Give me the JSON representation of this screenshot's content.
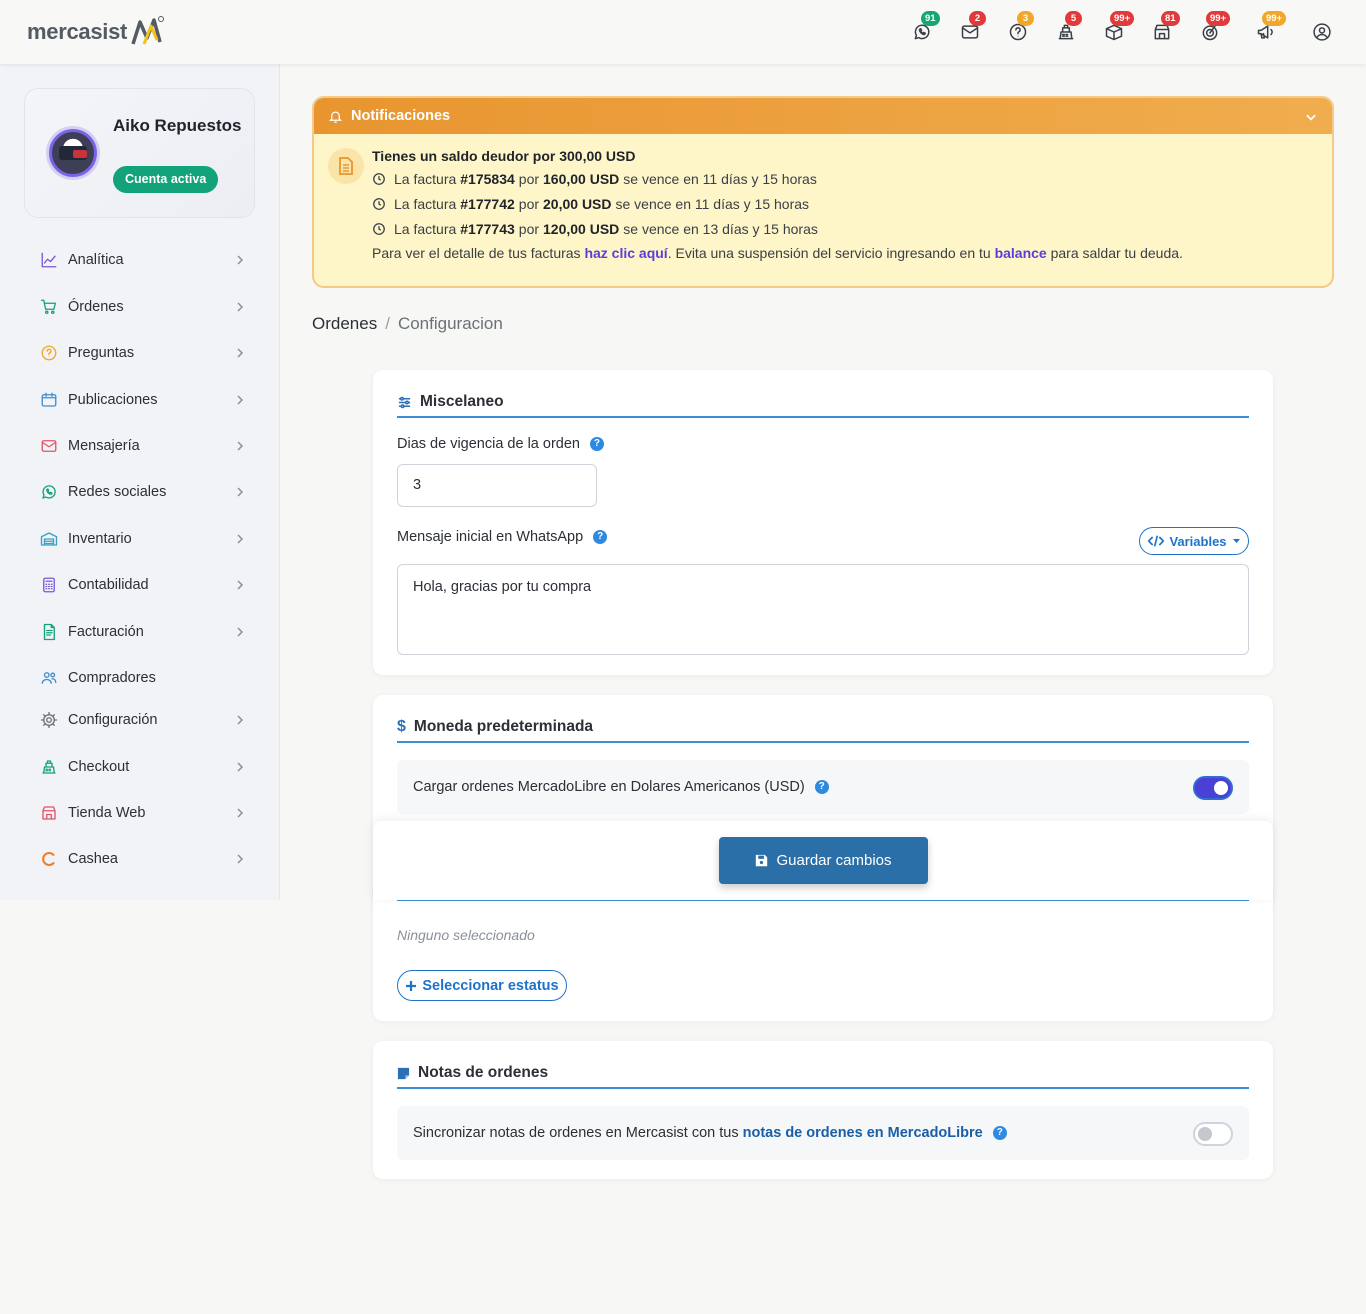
{
  "app": {
    "logo_text": "mercasist"
  },
  "topbar": {
    "icons": [
      {
        "name": "whatsapp-icon",
        "badge": "91",
        "color": "#17a673"
      },
      {
        "name": "mail-icon",
        "badge": "2",
        "color": "#e03a3a"
      },
      {
        "name": "question-icon",
        "badge": "3",
        "color": "#f0a72a"
      },
      {
        "name": "register-icon",
        "badge": "5",
        "color": "#e03a3a"
      },
      {
        "name": "package-icon",
        "badge": "99+",
        "color": "#e03a3a"
      },
      {
        "name": "store-icon",
        "badge": "81",
        "color": "#e03a3a"
      },
      {
        "name": "target-icon",
        "badge": "99+",
        "color": "#e03a3a"
      },
      {
        "name": "megaphone-icon",
        "badge": "99+",
        "color": "#f0a72a"
      },
      {
        "name": "user-icon",
        "badge": "",
        "color": ""
      }
    ]
  },
  "profile": {
    "name": "Aiko Repuestos",
    "status": "Cuenta activa"
  },
  "sidebar": {
    "items": [
      {
        "label": "Analítica",
        "icon": "chart-icon",
        "color": "#7a5ad9",
        "chevron": true
      },
      {
        "label": "Órdenes",
        "icon": "cart-icon",
        "color": "#12a37a",
        "chevron": true
      },
      {
        "label": "Preguntas",
        "icon": "question-icon",
        "color": "#f0a72a",
        "chevron": true
      },
      {
        "label": "Publicaciones",
        "icon": "calendar-icon",
        "color": "#3d8fd1",
        "chevron": true
      },
      {
        "label": "Mensajería",
        "icon": "mail-icon",
        "color": "#e0566b",
        "chevron": true
      },
      {
        "label": "Redes sociales",
        "icon": "whatsapp-icon",
        "color": "#12a37a",
        "chevron": true
      },
      {
        "label": "Inventario",
        "icon": "warehouse-icon",
        "color": "#3aa0c8",
        "chevron": true
      },
      {
        "label": "Contabilidad",
        "icon": "calculator-icon",
        "color": "#7a5ad9",
        "chevron": true
      },
      {
        "label": "Facturación",
        "icon": "invoice-icon",
        "color": "#12a37a",
        "chevron": true
      },
      {
        "label": "Compradores",
        "icon": "users-icon",
        "color": "#3d8fd1",
        "chevron": false
      },
      {
        "label": "Configuración",
        "icon": "gear-icon",
        "color": "#6b7178",
        "chevron": true
      },
      {
        "label": "Checkout",
        "icon": "register-icon",
        "color": "#12a37a",
        "chevron": true
      },
      {
        "label": "Tienda Web",
        "icon": "store-icon",
        "color": "#e0566b",
        "chevron": true
      },
      {
        "label": "Cashea",
        "icon": "cashea-icon",
        "color": "#f07f2a",
        "chevron": true
      }
    ]
  },
  "notifications": {
    "title": "Notificaciones",
    "debt_title": "Tienes un saldo deudor por 300,00 USD",
    "invoices": [
      {
        "prefix": "La factura",
        "number": "#175834",
        "por": "por",
        "amount": "160,00 USD",
        "due": "se vence en 11 días y 15 horas"
      },
      {
        "prefix": "La factura",
        "number": "#177742",
        "por": "por",
        "amount": "20,00 USD",
        "due": "se vence en 11 días y 15 horas"
      },
      {
        "prefix": "La factura",
        "number": "#177743",
        "por": "por",
        "amount": "120,00 USD",
        "due": "se vence en 13 días y 15 horas"
      }
    ],
    "footer_1": "Para ver el detalle de tus facturas ",
    "footer_link_1": "haz clic aquí",
    "footer_2": ". Evita una suspensión del servicio ingresando en tu ",
    "footer_link_2": "balance",
    "footer_3": " para saldar tu deuda."
  },
  "breadcrumb": {
    "root": "Ordenes",
    "sep": "/",
    "current": "Configuracion"
  },
  "miscelaneo": {
    "title": "Miscelaneo",
    "days_label": "Dias de vigencia de la orden",
    "days_value": "3",
    "whatsapp_label": "Mensaje inicial en WhatsApp",
    "variables_label": "Variables",
    "whatsapp_value": "Hola, gracias por tu compra",
    "help": "?"
  },
  "moneda": {
    "title": "Moneda predeterminada",
    "switch_label": "Cargar ordenes MercadoLibre en Dolares Americanos (USD)",
    "switch_on": true
  },
  "save": {
    "label": "Guardar cambios"
  },
  "estatus": {
    "empty_text": "Ninguno seleccionado",
    "select_label": "Seleccionar estatus"
  },
  "notas": {
    "title": "Notas de ordenes",
    "label_prefix": "Sincronizar notas de ordenes en Mercasist con tus",
    "label_link": "notas de ordenes en MercadoLibre",
    "switch_on": false
  }
}
